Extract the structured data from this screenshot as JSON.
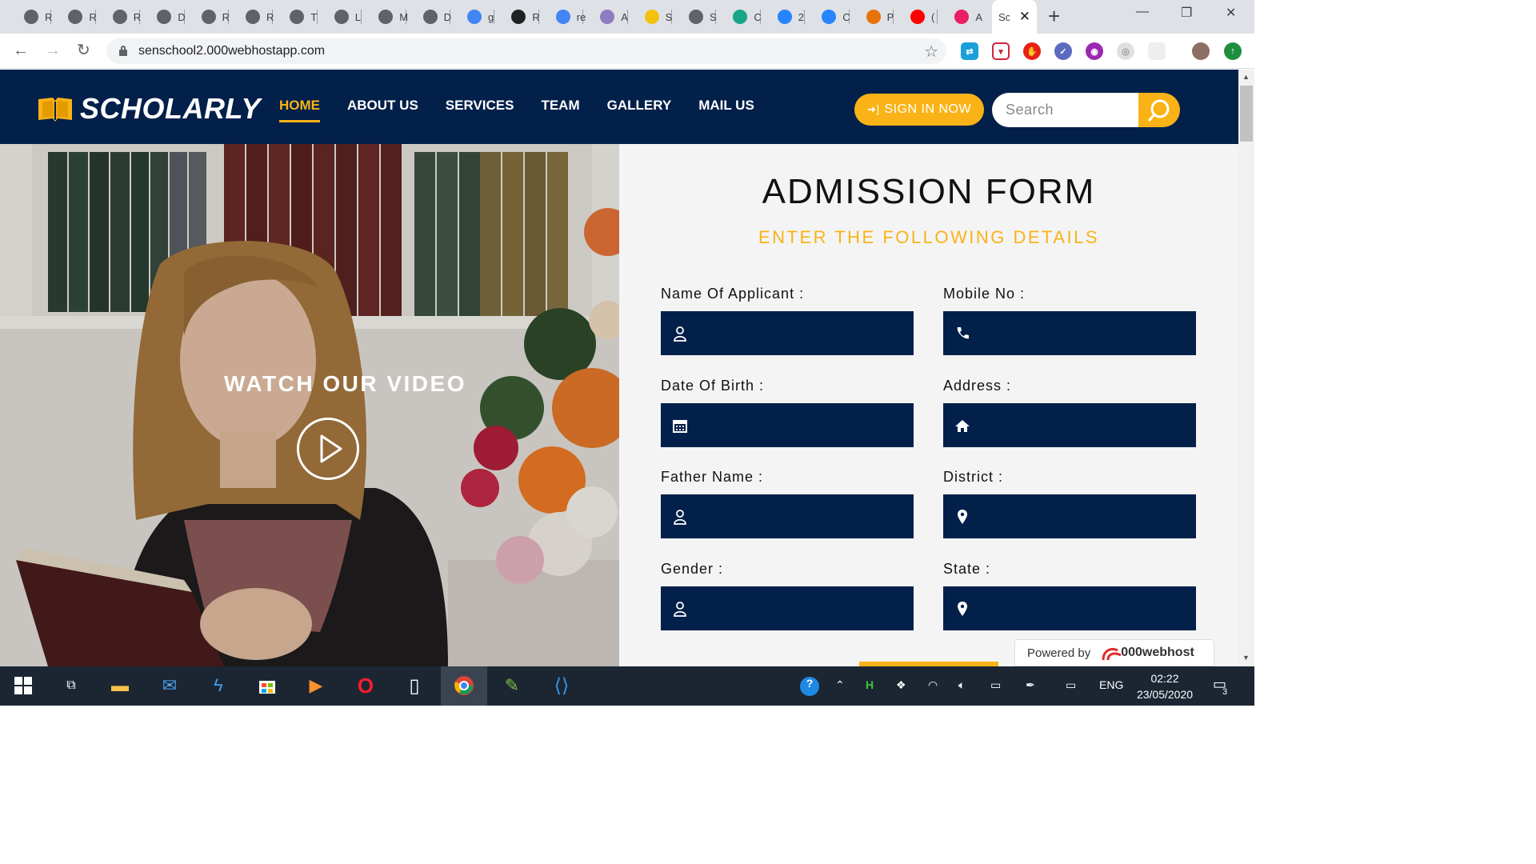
{
  "browser": {
    "tabs": [
      {
        "icon": "globe-icon",
        "label": "R",
        "color": "#5f6368"
      },
      {
        "icon": "globe-icon",
        "label": "R",
        "color": "#5f6368"
      },
      {
        "icon": "globe-icon",
        "label": "R",
        "color": "#5f6368"
      },
      {
        "icon": "globe-icon",
        "label": "D",
        "color": "#5f6368"
      },
      {
        "icon": "globe-icon",
        "label": "R",
        "color": "#5f6368"
      },
      {
        "icon": "globe-icon",
        "label": "R",
        "color": "#5f6368"
      },
      {
        "icon": "globe-icon",
        "label": "T",
        "color": "#5f6368"
      },
      {
        "icon": "globe-icon",
        "label": "L",
        "color": "#5f6368"
      },
      {
        "icon": "globe-icon",
        "label": "M",
        "color": "#5f6368"
      },
      {
        "icon": "globe-icon",
        "label": "D",
        "color": "#5f6368"
      },
      {
        "icon": "google-icon",
        "label": "g",
        "color": "#4285f4"
      },
      {
        "icon": "settings-icon",
        "label": "R",
        "color": "#202124"
      },
      {
        "icon": "google-icon",
        "label": "re",
        "color": "#4285f4"
      },
      {
        "icon": "knot-icon",
        "label": "A",
        "color": "#8e7cc3"
      },
      {
        "icon": "heart-icon",
        "label": "S",
        "color": "#f4c20d"
      },
      {
        "icon": "globe-icon",
        "label": "S",
        "color": "#5f6368"
      },
      {
        "icon": "diamond-icon",
        "label": "C",
        "color": "#17a589"
      },
      {
        "icon": "jira-icon",
        "label": "2",
        "color": "#2684ff"
      },
      {
        "icon": "jira-icon",
        "label": "C",
        "color": "#2684ff"
      },
      {
        "icon": "letter-a-icon",
        "label": "P",
        "color": "#e8710a"
      },
      {
        "icon": "youtube-icon",
        "label": "(",
        "color": "#ff0000"
      },
      {
        "icon": "w-icon",
        "label": "A",
        "color": "#e91e63"
      }
    ],
    "active_tab": {
      "label": "Sc"
    },
    "url": "senschool2.000webhostapp.com"
  },
  "site": {
    "logo": "SCHOLARLY",
    "nav": [
      {
        "label": "HOME",
        "active": true
      },
      {
        "label": "ABOUT US",
        "active": false
      },
      {
        "label": "SERVICES",
        "active": false
      },
      {
        "label": "TEAM",
        "active": false
      },
      {
        "label": "GALLERY",
        "active": false
      },
      {
        "label": "MAIL US",
        "active": false
      }
    ],
    "sign_in": "SIGN IN NOW",
    "search_placeholder": "Search",
    "accent": "#f9b316",
    "navy": "#03204a"
  },
  "hero": {
    "video_label": "WATCH OUR VIDEO"
  },
  "form": {
    "title": "ADMISSION FORM",
    "subtitle": "ENTER THE FOLLOWING DETAILS",
    "fields": [
      {
        "label": "Name Of Applicant :",
        "icon": "user-icon",
        "value": ""
      },
      {
        "label": "Mobile No :",
        "icon": "phone-icon",
        "value": ""
      },
      {
        "label": "Date Of Birth :",
        "icon": "calendar-icon",
        "value": ""
      },
      {
        "label": "Address :",
        "icon": "home-icon",
        "value": ""
      },
      {
        "label": "Father Name :",
        "icon": "user-icon",
        "value": ""
      },
      {
        "label": "District :",
        "icon": "map-pin-icon",
        "value": ""
      },
      {
        "label": "Gender :",
        "icon": "user-icon",
        "value": ""
      },
      {
        "label": "State :",
        "icon": "map-pin-icon",
        "value": ""
      }
    ]
  },
  "powered": {
    "prefix": "Powered by",
    "brand": "000webhost"
  },
  "taskbar": {
    "language": "ENG",
    "time": "02:22",
    "date": "23/05/2020",
    "notifications": "3"
  }
}
